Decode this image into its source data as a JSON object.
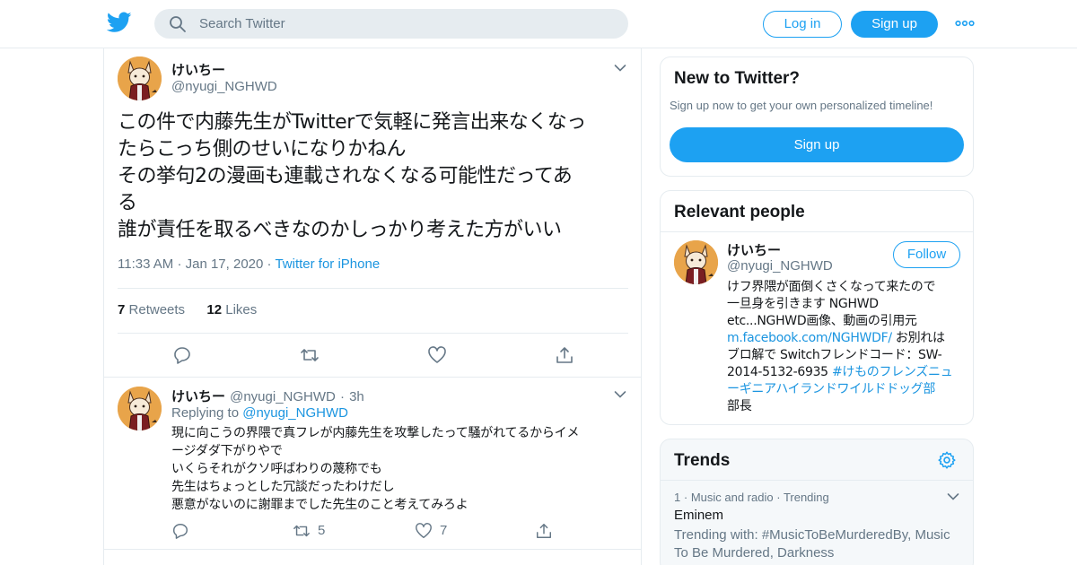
{
  "topbar": {
    "search_placeholder": "Search Twitter",
    "login_label": "Log in",
    "signup_label": "Sign up",
    "brand_color": "#1da1f2"
  },
  "tweet": {
    "author_name": "けいちー",
    "author_handle": "@nyugi_NGHWD",
    "text_lines": [
      "この件で内藤先生がTwitterで気軽に発言出来なくなっ",
      "たらこっち側のせいになりかねん",
      "その挙句2の漫画も連載されなくなる可能性だってあ",
      "る",
      "誰が責任を取るべきなのかしっかり考えた方がいい"
    ],
    "time": "11:33 AM",
    "date": "Jan 17, 2020",
    "source": "Twitter for iPhone",
    "retweets_count": "7",
    "retweets_label": "Retweets",
    "likes_count": "12",
    "likes_label": "Likes"
  },
  "reply": {
    "author_name": "けいちー",
    "author_handle": "@nyugi_NGHWD",
    "age": "3h",
    "replying_label": "Replying to",
    "replying_to": "@nyugi_NGHWD",
    "text_lines": [
      "現に向こうの界隈で真フレが内藤先生を攻撃したって騒がれてるからイメ",
      "ージダダ下がりやで",
      "いくらそれがクソ呼ばわりの蔑称でも",
      "先生はちょっとした冗談だったわけだし",
      "悪意がないのに謝罪までした先生のこと考えてみろよ"
    ],
    "retweets": "5",
    "likes": "7"
  },
  "new_to_twitter": {
    "title": "New to Twitter?",
    "subtitle": "Sign up now to get your own personalized timeline!",
    "signup_label": "Sign up"
  },
  "relevant_people": {
    "title": "Relevant people",
    "name": "けいちー",
    "handle": "@nyugi_NGHWD",
    "follow_label": "Follow",
    "bio": {
      "line1": "けフ界隈が面倒くさくなって来たので",
      "line2": "一旦身を引きます NGHWD",
      "line3": "etc...NGHWD画像、動画の引用元",
      "line4_link": "m.facebook.com/NGHWDF/",
      "line4_text": " お別れは",
      "line5": "ブロ解で Switchフレンドコード：SW-",
      "line6_text": "2014-5132-6935 ",
      "line6_link": "#けものフレンズニュ",
      "line7_link": "ーギニアハイランドワイルドドッグ部",
      "line8": "部長"
    }
  },
  "trends": {
    "title": "Trends",
    "items": [
      {
        "rank": "1",
        "category": "Music and radio",
        "status": "Trending",
        "name": "Eminem",
        "desc": "Trending with: #MusicToBeMurderedBy, Music To Be Murdered, Darkness"
      }
    ]
  }
}
